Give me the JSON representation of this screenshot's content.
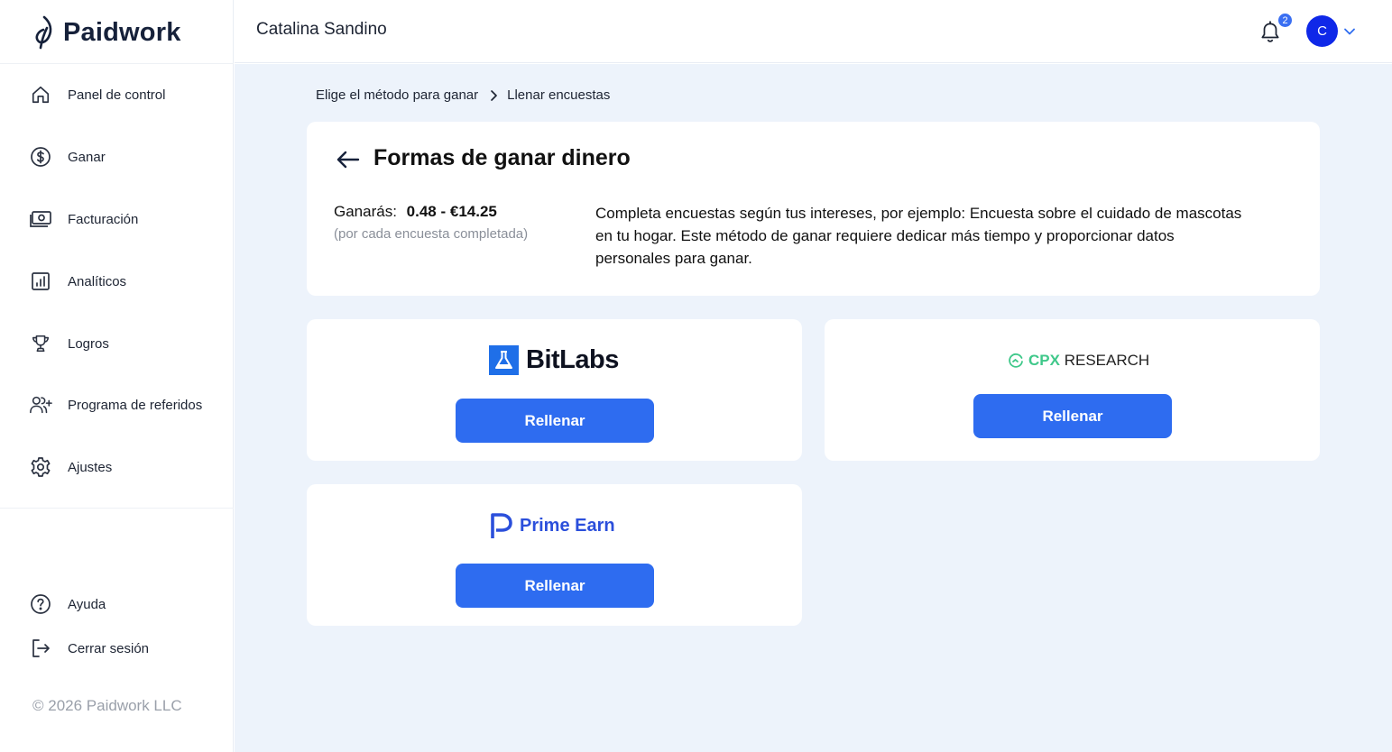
{
  "brand": {
    "name": "Paidwork",
    "copyright": "© 2026 Paidwork LLC"
  },
  "sidebar": {
    "items": [
      {
        "label": "Panel de control",
        "icon": "home-icon"
      },
      {
        "label": "Ganar",
        "icon": "dollar-circle-icon"
      },
      {
        "label": "Facturación",
        "icon": "banknote-icon"
      },
      {
        "label": "Analíticos",
        "icon": "bar-chart-icon"
      },
      {
        "label": "Logros",
        "icon": "trophy-icon"
      },
      {
        "label": "Programa de referidos",
        "icon": "users-plus-icon"
      },
      {
        "label": "Ajustes",
        "icon": "gear-icon"
      }
    ],
    "bottom": [
      {
        "label": "Ayuda",
        "icon": "help-circle-icon"
      },
      {
        "label": "Cerrar sesión",
        "icon": "logout-icon"
      }
    ]
  },
  "header": {
    "user_name": "Catalina Sandino",
    "notifications_count": "2",
    "avatar_initial": "C"
  },
  "breadcrumb": {
    "parent": "Elige el método para ganar",
    "current": "Llenar encuestas"
  },
  "info": {
    "title": "Formas de ganar dinero",
    "earn_label": "Ganarás:",
    "earn_range": "0.48 - €14.25",
    "earn_sub": "(por cada encuesta completada)",
    "description": "Completa encuestas según tus intereses, por ejemplo: Encuesta sobre el cuidado de mascotas en tu hogar. Este método de ganar requiere dedicar más tiempo y proporcionar datos personales para ganar."
  },
  "offers": [
    {
      "logo_text": "BitLabs",
      "button": "Rellenar"
    },
    {
      "logo_text_accent": "CPX",
      "logo_text": "RESEARCH",
      "button": "Rellenar"
    },
    {
      "logo_text": "Prime Earn",
      "button": "Rellenar"
    }
  ],
  "colors": {
    "primary": "#2e6cf0",
    "avatar": "#0f28e8",
    "main_bg": "#edf3fb",
    "cpx_green": "#3fc88a",
    "prime_blue": "#2b4fdb"
  }
}
